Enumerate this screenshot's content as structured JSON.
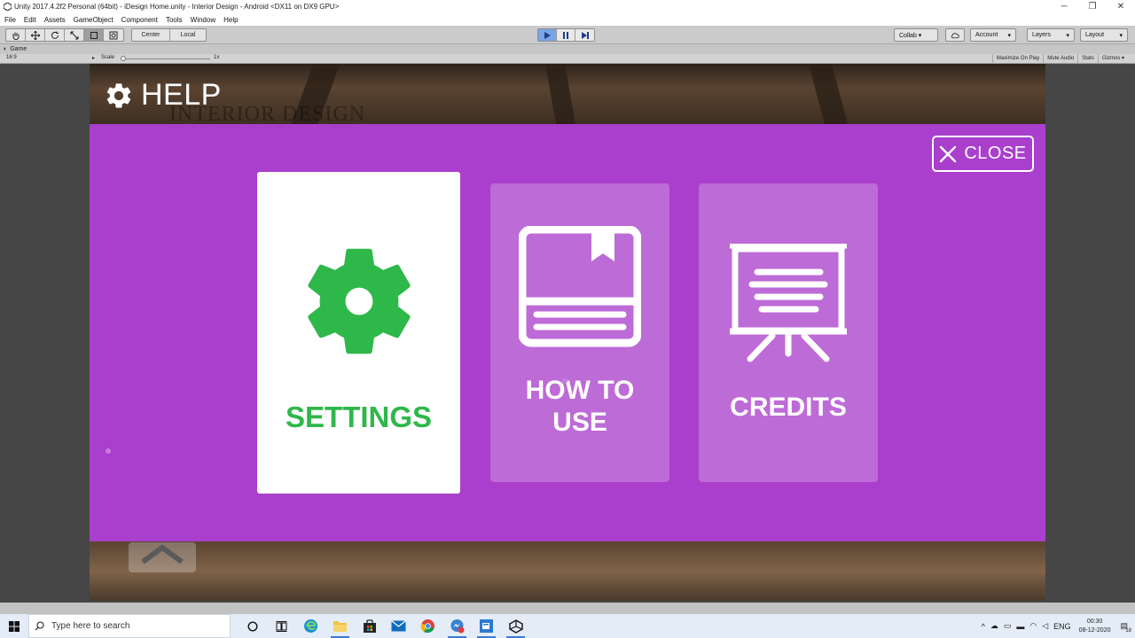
{
  "window": {
    "title": "Unity 2017.4.2f2 Personal (64bit) - iDesign Home.unity - Interior Design - Android <DX11 on DX9 GPU>",
    "controls": [
      "─",
      "❐",
      "✕"
    ]
  },
  "menu": [
    "File",
    "Edit",
    "Assets",
    "GameObject",
    "Component",
    "Tools",
    "Window",
    "Help"
  ],
  "toolbar": {
    "pivot_label": "Center",
    "space_label": "Local",
    "collab_label": "Collab ▾",
    "account_label": "Account",
    "layers_label": "Layers",
    "layout_label": "Layout"
  },
  "game_view": {
    "tab_label": "Game",
    "aspect": "16:9",
    "scale_label": "Scale",
    "scale_value": "1x",
    "right_buttons": [
      "Maximize On Play",
      "Mute Audio",
      "Stats",
      "Gizmos ▾"
    ]
  },
  "scene": {
    "faint_title": "INTERIOR DESIGN",
    "help_title": "HELP",
    "close_label": "CLOSE",
    "cards": {
      "settings": "SETTINGS",
      "howto_line1": "HOW TO",
      "howto_line2": "USE",
      "credits": "CREDITS"
    },
    "colors": {
      "panel": "#a93fcc",
      "card": "#bd6bd7",
      "settings_green": "#2eb84a"
    }
  },
  "taskbar": {
    "search_placeholder": "Type here to search",
    "icons": [
      "cortana-icon",
      "task-view-icon",
      "edge-icon",
      "file-explorer-icon",
      "store-icon",
      "mail-icon",
      "chrome-icon",
      "messenger-icon",
      "visual-studio-icon",
      "unity-icon"
    ],
    "language": "ENG",
    "time": "00:30",
    "date": "08-12-2020",
    "notification_count": "18"
  }
}
